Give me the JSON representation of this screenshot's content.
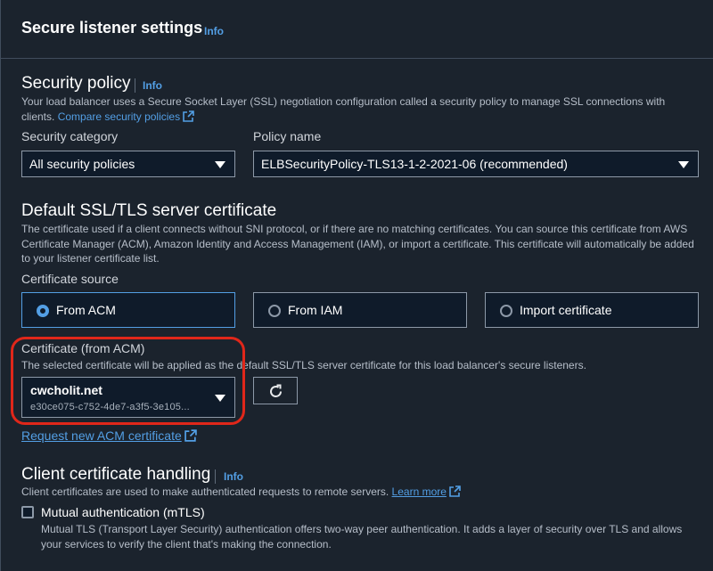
{
  "header": {
    "title": "Secure listener settings",
    "info": "Info"
  },
  "security_policy": {
    "heading": "Security policy",
    "info": "Info",
    "description": "Your load balancer uses a Secure Socket Layer (SSL) negotiation configuration called a security policy to manage SSL connections with clients.",
    "link": "Compare security policies",
    "category_label": "Security category",
    "category_value": "All security policies",
    "policy_label": "Policy name",
    "policy_value": "ELBSecurityPolicy-TLS13-1-2-2021-06 (recommended)"
  },
  "default_cert": {
    "heading": "Default SSL/TLS server certificate",
    "description": "The certificate used if a client connects without SNI protocol, or if there are no matching certificates. You can source this certificate from AWS Certificate Manager (ACM), Amazon Identity and Access Management (IAM), or import a certificate. This certificate will automatically be added to your listener certificate list.",
    "source_label": "Certificate source",
    "sources": [
      {
        "label": "From ACM",
        "selected": true
      },
      {
        "label": "From IAM",
        "selected": false
      },
      {
        "label": "Import certificate",
        "selected": false
      }
    ],
    "acm_label": "Certificate (from ACM)",
    "acm_description": "The selected certificate will be applied as the default SSL/TLS server certificate for this load balancer's secure listeners.",
    "cert_name": "cwcholit.net",
    "cert_id": "e30ce075-c752-4de7-a3f5-3e105...",
    "request_link": "Request new ACM certificate"
  },
  "client_cert": {
    "heading": "Client certificate handling",
    "info": "Info",
    "description": "Client certificates are used to make authenticated requests to remote servers.",
    "learn_more": "Learn more",
    "mtls_label": "Mutual authentication (mTLS)",
    "mtls_checked": false,
    "mtls_description": "Mutual TLS (Transport Layer Security) authentication offers two-way peer authentication. It adds a layer of security over TLS and allows your services to verify the client that's making the connection."
  },
  "colors": {
    "accent": "#539fe5",
    "highlight": "#e0271a",
    "background": "#1b232d"
  },
  "icons": [
    "external-link-icon",
    "refresh-icon",
    "chevron-down-icon"
  ]
}
